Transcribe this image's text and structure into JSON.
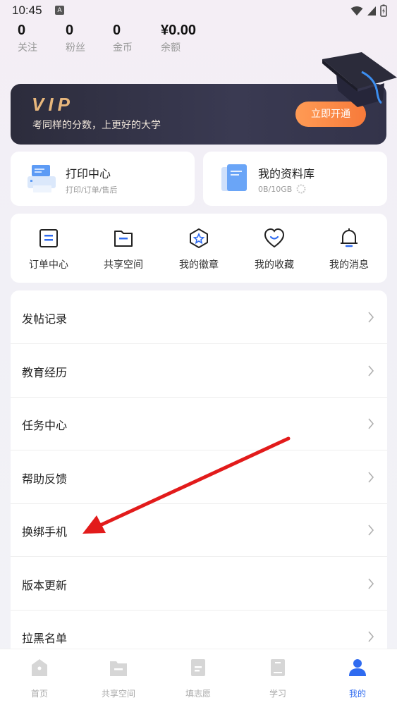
{
  "status_bar": {
    "time": "10:45",
    "notification_badge": "A"
  },
  "stats": [
    {
      "value": "0",
      "label": "关注"
    },
    {
      "value": "0",
      "label": "粉丝"
    },
    {
      "value": "0",
      "label": "金币"
    },
    {
      "value": "¥0.00",
      "label": "余额"
    }
  ],
  "vip": {
    "logo": "VIP",
    "subtitle": "考同样的分数，上更好的大学",
    "button": "立即开通",
    "colors": {
      "gold": "#e8b77c",
      "button": "#f77a3a"
    }
  },
  "cards": {
    "print": {
      "title": "打印中心",
      "subtitle": "打印/订单/售后",
      "icon": "printer-icon"
    },
    "library": {
      "title": "我的资料库",
      "usage": "0B/10GB",
      "icon": "documents-icon"
    }
  },
  "quick_actions": [
    {
      "label": "订单中心",
      "icon": "order-icon"
    },
    {
      "label": "共享空间",
      "icon": "folder-icon"
    },
    {
      "label": "我的徽章",
      "icon": "badge-icon"
    },
    {
      "label": "我的收藏",
      "icon": "heart-icon"
    },
    {
      "label": "我的消息",
      "icon": "bell-icon"
    }
  ],
  "menu": [
    {
      "label": "发帖记录"
    },
    {
      "label": "教育经历"
    },
    {
      "label": "任务中心"
    },
    {
      "label": "帮助反馈"
    },
    {
      "label": "换绑手机"
    },
    {
      "label": "版本更新"
    },
    {
      "label": "拉黑名单"
    }
  ],
  "bottom_nav": [
    {
      "label": "首页",
      "icon": "home-icon",
      "active": false
    },
    {
      "label": "共享空间",
      "icon": "share-space-icon",
      "active": false
    },
    {
      "label": "填志愿",
      "icon": "application-icon",
      "active": false
    },
    {
      "label": "学习",
      "icon": "book-icon",
      "active": false
    },
    {
      "label": "我的",
      "icon": "profile-icon",
      "active": true
    }
  ],
  "accent_color": "#2f6bf0",
  "annotation_color": "#e21b1b"
}
